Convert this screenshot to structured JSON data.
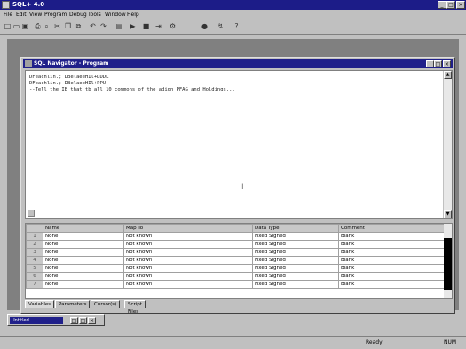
{
  "app": {
    "title": "SQL+ 4.0",
    "menus": [
      "File",
      "Edit",
      "View",
      "Program",
      "Debug",
      "Tools",
      "Window",
      "Help"
    ],
    "controls": [
      "_",
      "□",
      "×"
    ]
  },
  "sql_window": {
    "title": "SQL Navigator - Program",
    "code_lines": [
      "DFeachlin.; DBelaeeHIl+DDDL",
      "DFeachlin.; DBelaeeHIl+PPU",
      "--Tell the IB that tb all 10 commons of the adign PFAG and Holdings..."
    ],
    "controls": [
      "_",
      "□",
      "×"
    ],
    "cursor_glyph": "I"
  },
  "grid": {
    "columns": [
      "Name",
      "Map To",
      "Data Type",
      "Comment"
    ],
    "rows": [
      {
        "num": "1",
        "name": "None",
        "map": "Not known",
        "type": "Fixed Signed",
        "comment": "Blank"
      },
      {
        "num": "2",
        "name": "None",
        "map": "Not known",
        "type": "Fixed Signed",
        "comment": "Blank"
      },
      {
        "num": "3",
        "name": "None",
        "map": "Not known",
        "type": "Fixed Signed",
        "comment": "Blank"
      },
      {
        "num": "4",
        "name": "None",
        "map": "Not known",
        "type": "Fixed Signed",
        "comment": "Blank"
      },
      {
        "num": "5",
        "name": "None",
        "map": "Not known",
        "type": "Fixed Signed",
        "comment": "Blank"
      },
      {
        "num": "6",
        "name": "None",
        "map": "Not known",
        "type": "Fixed Signed",
        "comment": "Blank"
      },
      {
        "num": "7",
        "name": "None",
        "map": "Not known",
        "type": "Fixed Signed",
        "comment": "Blank"
      }
    ]
  },
  "tabs": [
    "Variables",
    "Parameters",
    "Cursor(s)",
    "Script Files"
  ],
  "minimized": {
    "title": "Untitled"
  },
  "status": {
    "left": "Ready",
    "right": "NUM"
  },
  "colors": {
    "title_bar": "#1c1c88",
    "face": "#c0c0c0",
    "desktop": "#808080"
  }
}
